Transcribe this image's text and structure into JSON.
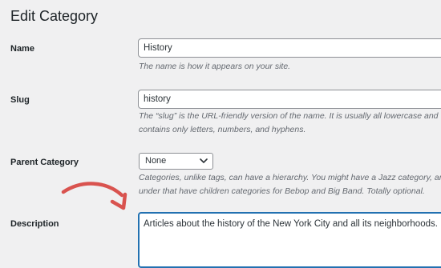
{
  "page": {
    "title": "Edit Category"
  },
  "form": {
    "name": {
      "label": "Name",
      "value": "History",
      "help": "The name is how it appears on your site."
    },
    "slug": {
      "label": "Slug",
      "value": "history",
      "help_line1": "The “slug” is the URL-friendly version of the name. It is usually all lowercase and",
      "help_line2": "contains only letters, numbers, and hyphens."
    },
    "parent": {
      "label": "Parent Category",
      "selected": "None",
      "help_line1": "Categories, unlike tags, can have a hierarchy. You might have a Jazz category, and",
      "help_line2": "under that have children categories for Bebop and Big Band. Totally optional."
    },
    "description": {
      "label": "Description",
      "value": "Articles about the history of the New York City and all its neighborhoods."
    }
  },
  "colors": {
    "background": "#f0f0f1",
    "focus_border": "#2271b1",
    "annotation_arrow": "#d9534f"
  },
  "icons": {
    "select_chevron": "chevron-down-icon",
    "annotation": "curved-arrow-icon"
  }
}
